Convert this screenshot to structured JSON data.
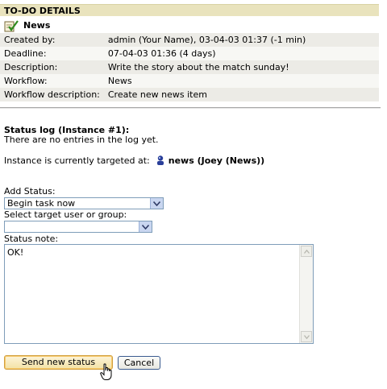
{
  "header": {
    "title": "TO-DO DETAILS"
  },
  "item": {
    "icon": "todo-check-icon",
    "title": "News"
  },
  "details": [
    {
      "label": "Created by:",
      "value": "admin (Your Name), 03-04-03 01:37 (-1 min)"
    },
    {
      "label": "Deadline:",
      "value": "07-04-03 01:36 (4 days)"
    },
    {
      "label": "Description:",
      "value": "Write the story about the match sunday!"
    },
    {
      "label": "Workflow:",
      "value": "News"
    },
    {
      "label": "Workflow description:",
      "value": "Create new news item"
    }
  ],
  "status_log": {
    "heading": "Status log (Instance #1):",
    "empty_text": "There are no entries in the log yet.",
    "targeted_label": "Instance is currently targeted at:",
    "target_icon": "user-icon",
    "target_value": "news (Joey (News))"
  },
  "form": {
    "add_status_label": "Add Status:",
    "add_status_value": "Begin task now",
    "target_label": "Select target user or group:",
    "target_value": "",
    "note_label": "Status note:",
    "note_value": "OK!",
    "send_label": "Send new status",
    "cancel_label": "Cancel"
  }
}
